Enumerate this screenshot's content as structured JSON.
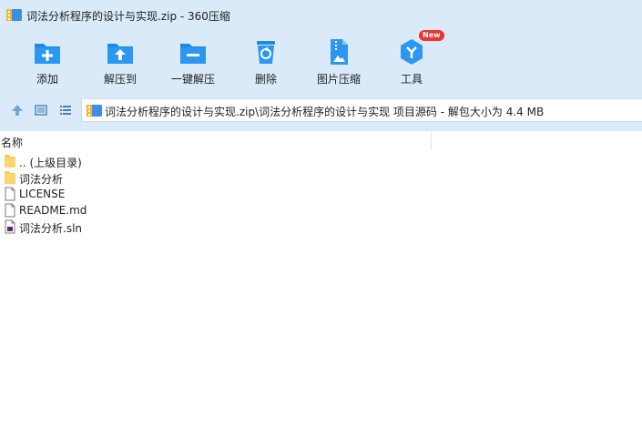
{
  "window": {
    "title": "词法分析程序的设计与实现.zip - 360压缩"
  },
  "toolbar": {
    "items": [
      {
        "label": "添加",
        "icon": "add-icon"
      },
      {
        "label": "解压到",
        "icon": "extract-to-icon"
      },
      {
        "label": "一键解压",
        "icon": "one-click-extract-icon"
      },
      {
        "label": "删除",
        "icon": "delete-icon"
      },
      {
        "label": "图片压缩",
        "icon": "image-compress-icon"
      },
      {
        "label": "工具",
        "icon": "tools-icon",
        "badge": "New"
      }
    ]
  },
  "address": {
    "path": "词法分析程序的设计与实现.zip\\词法分析程序的设计与实现 项目源码 - 解包大小为 4.4 MB"
  },
  "list": {
    "column_name": "名称",
    "items": [
      {
        "name": ".. (上级目录)",
        "type": "folder"
      },
      {
        "name": "词法分析",
        "type": "folder"
      },
      {
        "name": "LICENSE",
        "type": "file"
      },
      {
        "name": "README.md",
        "type": "file"
      },
      {
        "name": "词法分析.sln",
        "type": "sln"
      }
    ]
  },
  "colors": {
    "toolbar_bg": "#dbeaf9",
    "icon_blue": "#1e8ae6",
    "badge_red": "#e8352d"
  }
}
